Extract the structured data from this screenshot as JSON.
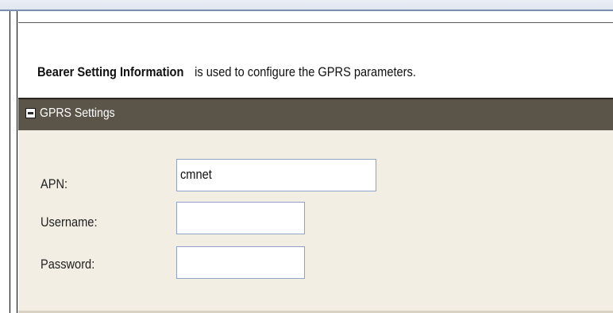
{
  "info": {
    "title": "Bearer Setting Information",
    "description": "is used to configure the GPRS parameters."
  },
  "panel": {
    "title": "GPRS Settings"
  },
  "fields": {
    "apn": {
      "label": "APN:",
      "value": "cmnet"
    },
    "username": {
      "label": "Username:",
      "value": ""
    },
    "password": {
      "label": "Password:",
      "value": ""
    }
  },
  "colors": {
    "panel_header": "#5b5449",
    "panel_body": "#f2eee4",
    "input_border": "#8fa3c7"
  },
  "icons": {
    "collapse": "minus-box-icon"
  }
}
